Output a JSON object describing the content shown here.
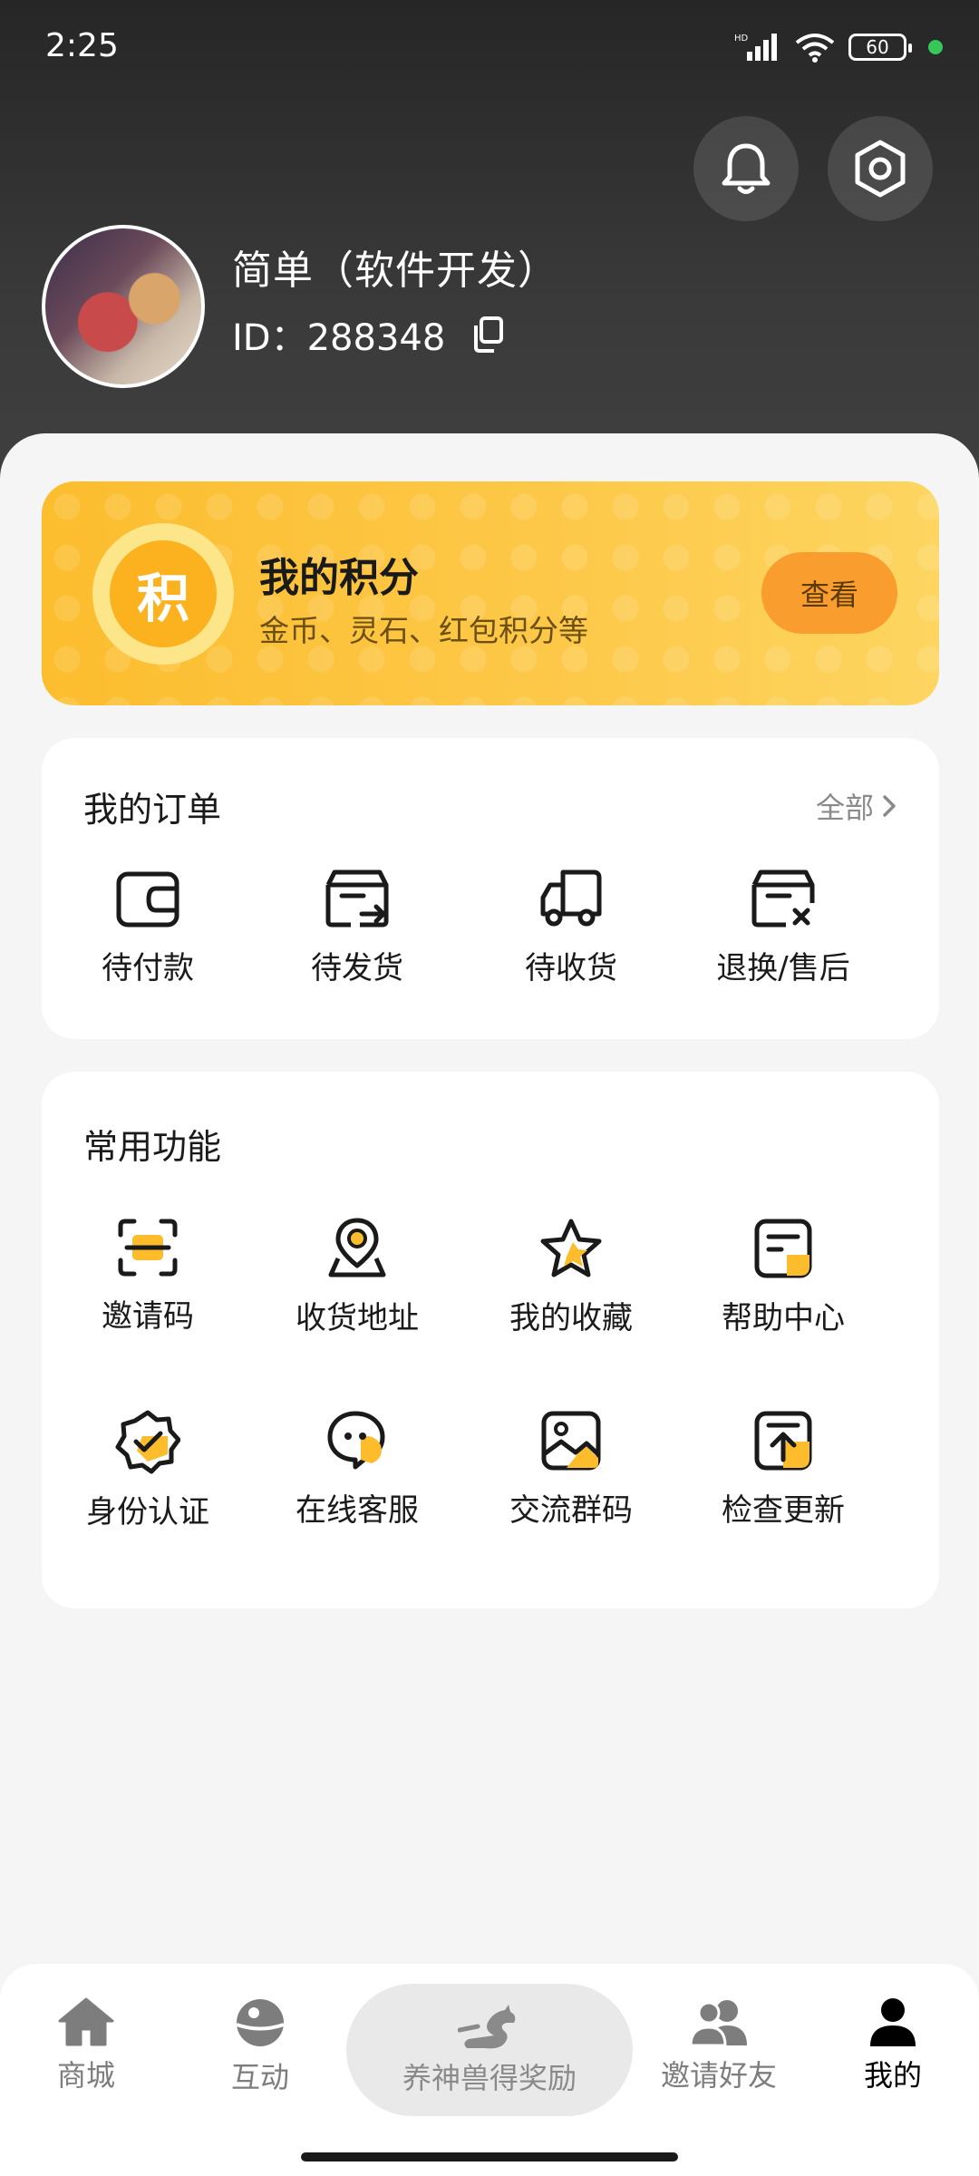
{
  "status_bar": {
    "time": "2:25",
    "battery": "60",
    "signal_label": "HD"
  },
  "header": {
    "user_name": "简单（软件开发）",
    "id_label": "ID：",
    "id_value": "288348"
  },
  "points": {
    "badge_char": "积",
    "title": "我的积分",
    "subtitle": "金币、灵石、红包积分等",
    "view_label": "查看"
  },
  "orders": {
    "title": "我的订单",
    "see_all": "全部",
    "items": [
      {
        "label": "待付款",
        "icon": "wallet-icon"
      },
      {
        "label": "待发货",
        "icon": "box-send-icon"
      },
      {
        "label": "待收货",
        "icon": "truck-icon"
      },
      {
        "label": "退换/售后",
        "icon": "box-return-icon"
      }
    ]
  },
  "functions": {
    "title": "常用功能",
    "items": [
      {
        "label": "邀请码",
        "icon": "scan-code-icon"
      },
      {
        "label": "收货地址",
        "icon": "location-icon"
      },
      {
        "label": "我的收藏",
        "icon": "star-icon"
      },
      {
        "label": "帮助中心",
        "icon": "help-doc-icon"
      },
      {
        "label": "身份认证",
        "icon": "verified-badge-icon"
      },
      {
        "label": "在线客服",
        "icon": "chat-bubble-icon"
      },
      {
        "label": "交流群码",
        "icon": "image-icon"
      },
      {
        "label": "检查更新",
        "icon": "update-upload-icon"
      }
    ]
  },
  "tabbar": {
    "items": [
      {
        "label": "商城",
        "icon": "home-icon"
      },
      {
        "label": "互动",
        "icon": "planet-icon"
      },
      {
        "label": "养神兽得奖励",
        "icon": "dragon-icon"
      },
      {
        "label": "邀请好友",
        "icon": "friends-icon"
      },
      {
        "label": "我的",
        "icon": "user-icon",
        "active": true
      }
    ]
  },
  "colors": {
    "accent": "#fcbc2c",
    "accent_dark": "#fa9d2f",
    "header_bg": "#333333"
  }
}
